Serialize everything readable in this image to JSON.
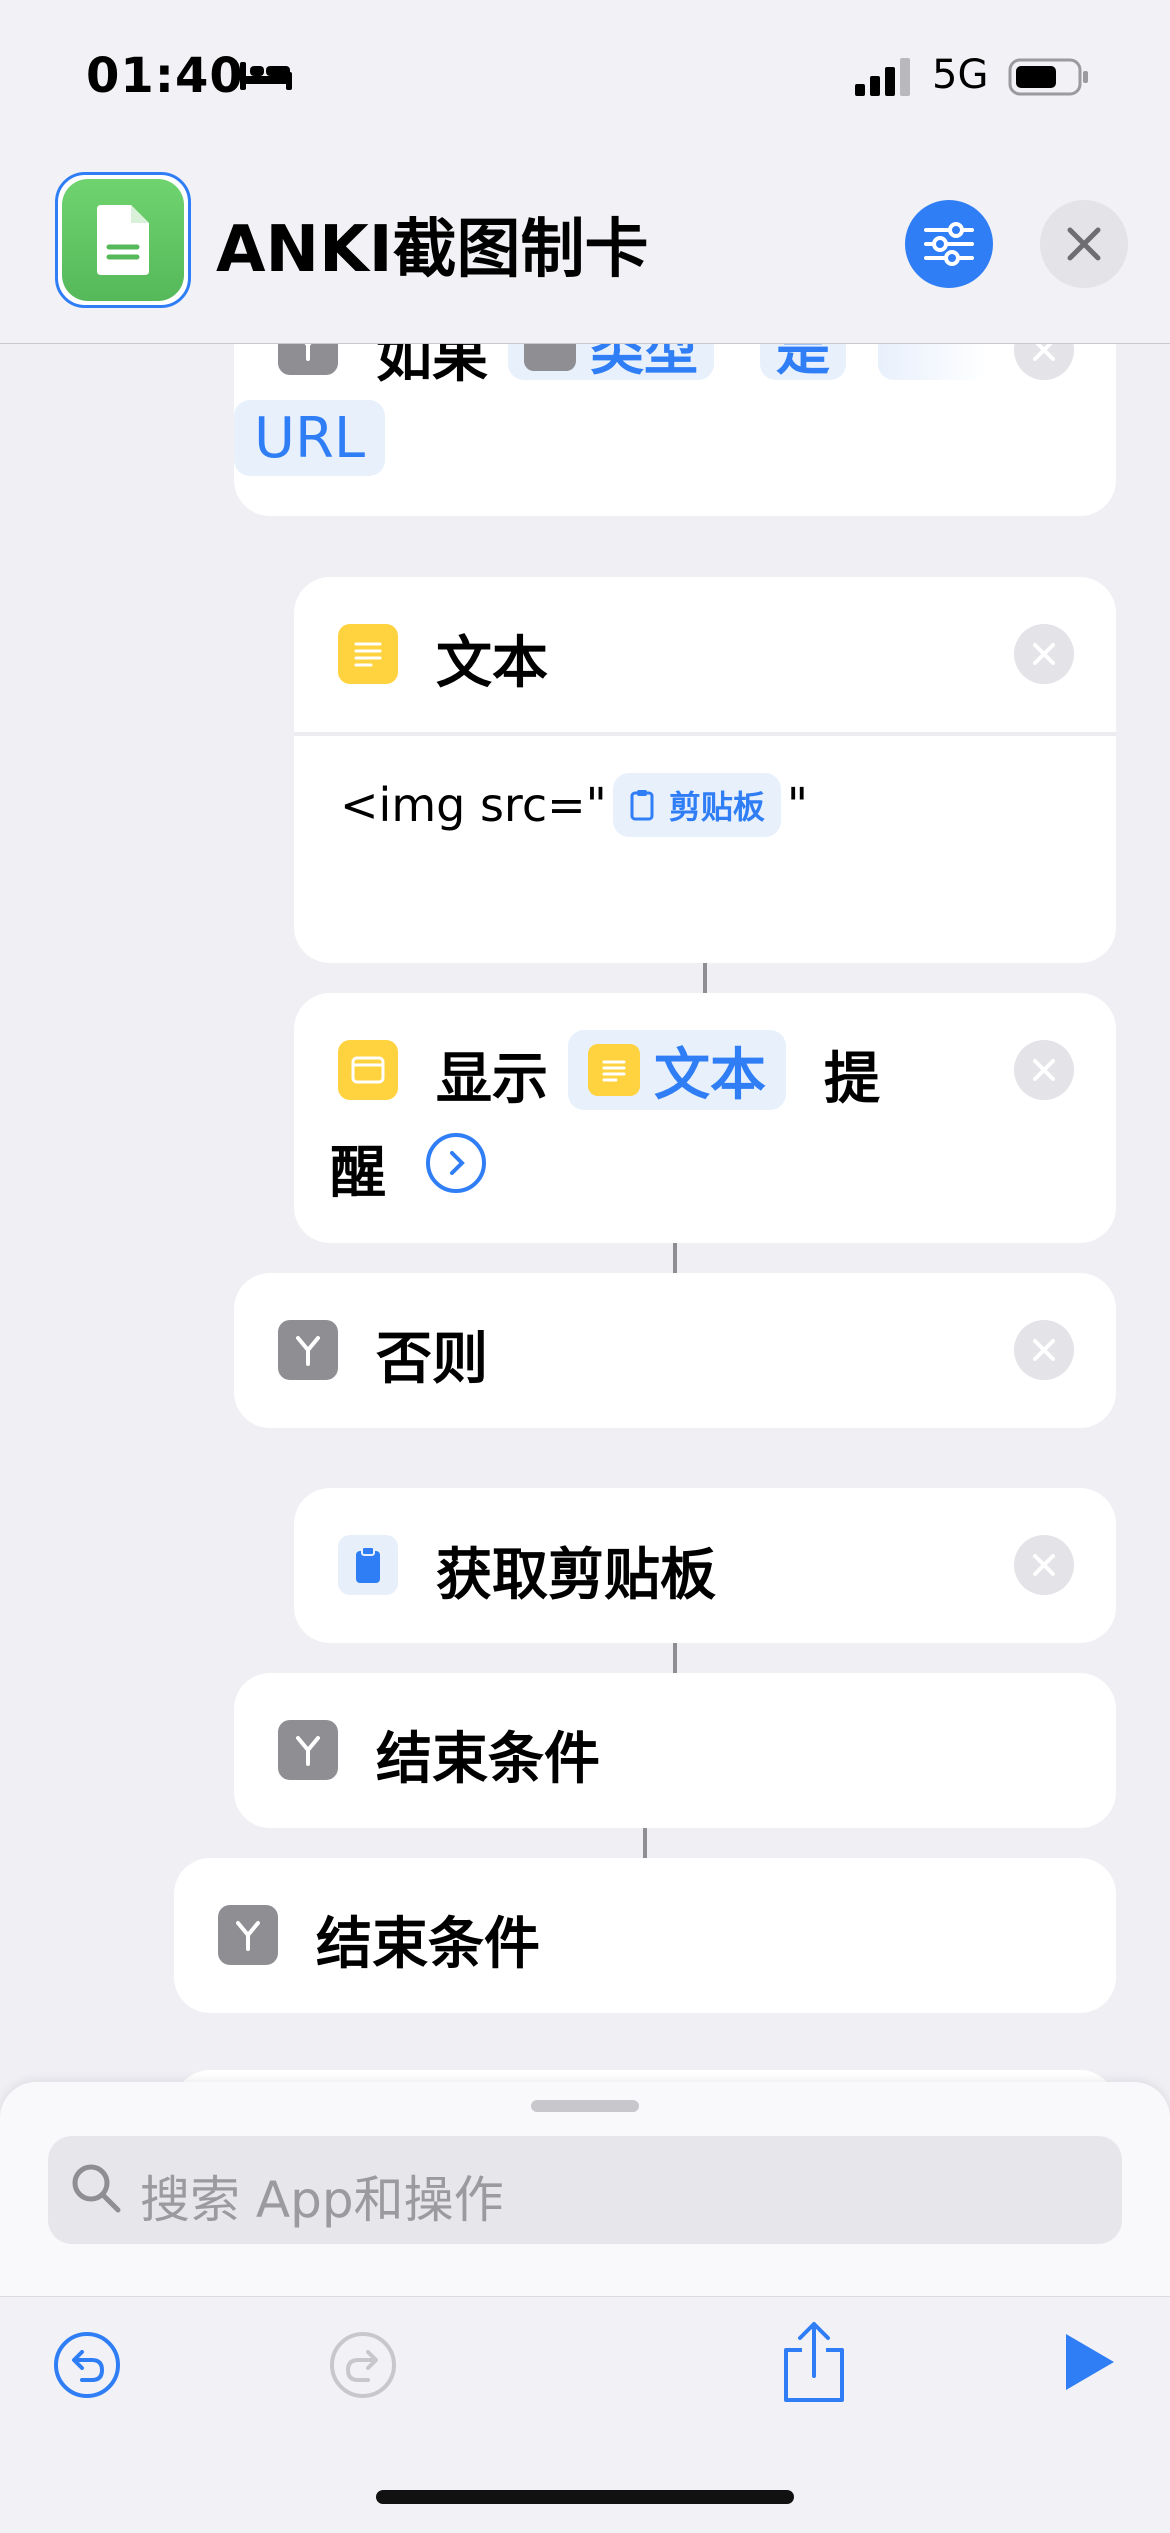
{
  "status_bar": {
    "time": "01:40",
    "network": "5G"
  },
  "header": {
    "title": "ANKI截图制卡"
  },
  "if_card": {
    "keyword": "如果",
    "tokens": [
      "类型",
      "是"
    ],
    "value": "URL"
  },
  "text_card": {
    "label": "文本",
    "content_prefix": "<img src=\"",
    "clipboard_token": "剪贴板",
    "content_suffix": "\""
  },
  "alert_card": {
    "label_1": "显示",
    "token": "文本",
    "label_2": "提",
    "label_3": "醒"
  },
  "otherwise_card": {
    "label": "否则"
  },
  "get_clipboard_card": {
    "label": "获取剪贴板"
  },
  "end_if_inner": {
    "label": "结束条件"
  },
  "end_if_outer": {
    "label": "结束条件"
  },
  "search": {
    "placeholder": "搜索 App和操作"
  },
  "colors": {
    "accent": "#2f7ef6",
    "icon_green": "#55b95a",
    "icon_yellow": "#ffd23f",
    "icon_gray": "#8e8e93"
  }
}
